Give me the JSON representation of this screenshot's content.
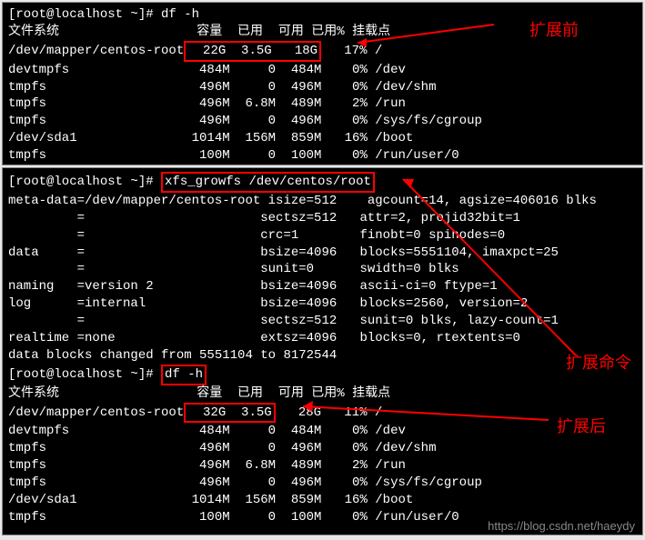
{
  "terminal1": {
    "prompt": "[root@localhost ~]# ",
    "cmd": "df -h",
    "header": {
      "fs": "文件系统",
      "size": "容量",
      "used": "已用",
      "avail": "可用",
      "usep": "已用%",
      "mount": "挂载点"
    },
    "rows": [
      {
        "fs": "/dev/mapper/centos-root",
        "size": "22G",
        "used": "3.5G",
        "avail": "18G",
        "usep": "17%",
        "mount": "/"
      },
      {
        "fs": "devtmpfs",
        "size": "484M",
        "used": "0",
        "avail": "484M",
        "usep": "0%",
        "mount": "/dev"
      },
      {
        "fs": "tmpfs",
        "size": "496M",
        "used": "0",
        "avail": "496M",
        "usep": "0%",
        "mount": "/dev/shm"
      },
      {
        "fs": "tmpfs",
        "size": "496M",
        "used": "6.8M",
        "avail": "489M",
        "usep": "2%",
        "mount": "/run"
      },
      {
        "fs": "tmpfs",
        "size": "496M",
        "used": "0",
        "avail": "496M",
        "usep": "0%",
        "mount": "/sys/fs/cgroup"
      },
      {
        "fs": "/dev/sda1",
        "size": "1014M",
        "used": "156M",
        "avail": "859M",
        "usep": "16%",
        "mount": "/boot"
      },
      {
        "fs": "tmpfs",
        "size": "100M",
        "used": "0",
        "avail": "100M",
        "usep": "0%",
        "mount": "/run/user/0"
      }
    ],
    "annotation_before": "扩展前"
  },
  "terminal2": {
    "prompt": "[root@localhost ~]# ",
    "cmd1": "xfs_growfs /dev/centos/root",
    "xfs_output": [
      "meta-data=/dev/mapper/centos-root isize=512    agcount=14, agsize=406016 blks",
      "         =                       sectsz=512   attr=2, projid32bit=1",
      "         =                       crc=1        finobt=0 spinodes=0",
      "data     =                       bsize=4096   blocks=5551104, imaxpct=25",
      "         =                       sunit=0      swidth=0 blks",
      "naming   =version 2              bsize=4096   ascii-ci=0 ftype=1",
      "log      =internal               bsize=4096   blocks=2560, version=2",
      "         =                       sectsz=512   sunit=0 blks, lazy-count=1",
      "realtime =none                   extsz=4096   blocks=0, rtextents=0",
      "data blocks changed from 5551104 to 8172544"
    ],
    "cmd2": "df -h",
    "header": {
      "fs": "文件系统",
      "size": "容量",
      "used": "已用",
      "avail": "可用",
      "usep": "已用%",
      "mount": "挂载点"
    },
    "rows": [
      {
        "fs": "/dev/mapper/centos-root",
        "size": "32G",
        "used": "3.5G",
        "avail": "28G",
        "usep": "11%",
        "mount": "/"
      },
      {
        "fs": "devtmpfs",
        "size": "484M",
        "used": "0",
        "avail": "484M",
        "usep": "0%",
        "mount": "/dev"
      },
      {
        "fs": "tmpfs",
        "size": "496M",
        "used": "0",
        "avail": "496M",
        "usep": "0%",
        "mount": "/dev/shm"
      },
      {
        "fs": "tmpfs",
        "size": "496M",
        "used": "6.8M",
        "avail": "489M",
        "usep": "2%",
        "mount": "/run"
      },
      {
        "fs": "tmpfs",
        "size": "496M",
        "used": "0",
        "avail": "496M",
        "usep": "0%",
        "mount": "/sys/fs/cgroup"
      },
      {
        "fs": "/dev/sda1",
        "size": "1014M",
        "used": "156M",
        "avail": "859M",
        "usep": "16%",
        "mount": "/boot"
      },
      {
        "fs": "tmpfs",
        "size": "100M",
        "used": "0",
        "avail": "100M",
        "usep": "0%",
        "mount": "/run/user/0"
      }
    ],
    "annotation_cmd": "扩展命令",
    "annotation_after": "扩展后",
    "watermark": "https://blog.csdn.net/haeydy"
  }
}
